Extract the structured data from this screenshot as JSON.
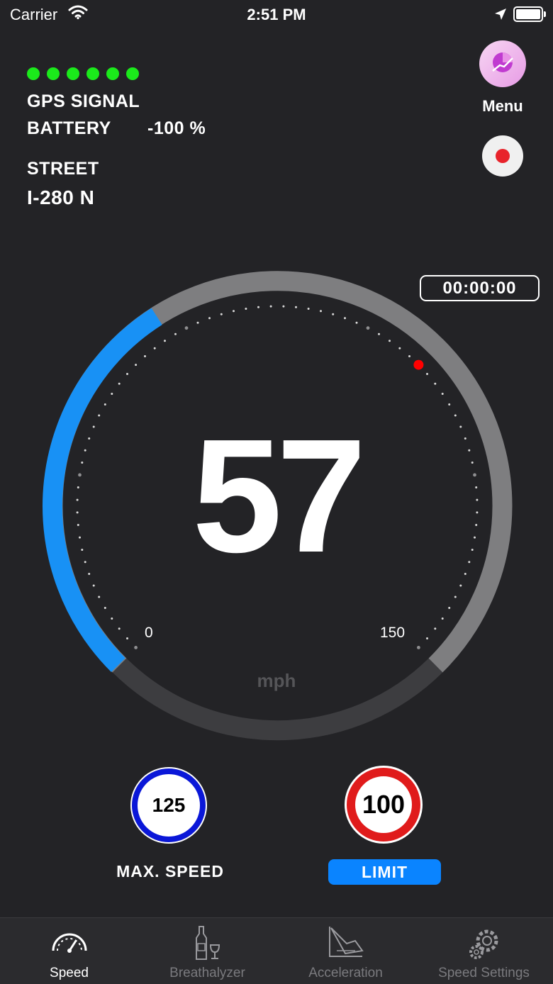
{
  "status_bar": {
    "carrier": "Carrier",
    "time": "2:51 PM"
  },
  "gps": {
    "signal_bars": 6,
    "label": "GPS SIGNAL",
    "color": "#1bea1b"
  },
  "battery": {
    "label": "BATTERY",
    "value": "-100 %"
  },
  "street": {
    "label": "STREET",
    "value": "I-280 N"
  },
  "menu": {
    "label": "Menu",
    "icon": "menu-chart-icon"
  },
  "record": {
    "icon": "record-icon"
  },
  "timer": "00:00:00",
  "gauge": {
    "speed": "57",
    "unit": "mph",
    "min_label": "0",
    "max_label": "150",
    "min": 0,
    "max": 150,
    "value": 57,
    "limit_marker": 100,
    "progress_color": "#1891f5",
    "limit_color": "#ff0000"
  },
  "max_speed": {
    "value": "125",
    "label": "MAX. SPEED"
  },
  "limit": {
    "value": "100",
    "label": "LIMIT"
  },
  "tabs": [
    {
      "label": "Speed",
      "icon": "speedometer-icon",
      "active": true
    },
    {
      "label": "Breathalyzer",
      "icon": "bottle-glass-icon",
      "active": false
    },
    {
      "label": "Acceleration",
      "icon": "acceleration-icon",
      "active": false
    },
    {
      "label": "Speed Settings",
      "icon": "gear-icon",
      "active": false
    }
  ]
}
